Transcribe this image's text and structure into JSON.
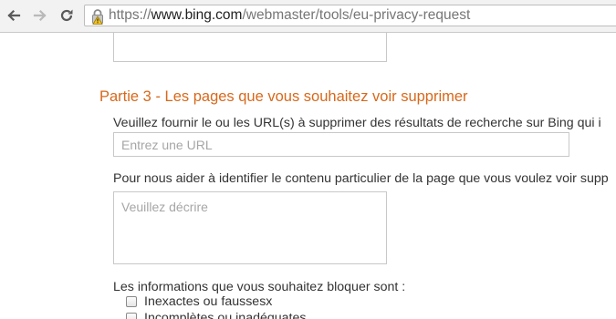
{
  "browser": {
    "url_scheme": "https://",
    "url_host": "www.bing.com",
    "url_path": "/webmaster/tools/eu-privacy-request",
    "icons": {
      "back": "back-arrow-icon",
      "forward": "forward-arrow-icon",
      "reload": "reload-icon",
      "security": "lock-warning-icon"
    }
  },
  "section": {
    "title": "Partie 3 - Les pages que vous souhaitez voir supprimer",
    "title_color": "#d8681a"
  },
  "url_field": {
    "label": "Veuillez fournir le ou les URL(s) à supprimer des résultats de recherche sur Bing qui i",
    "placeholder": "Entrez une URL",
    "value": ""
  },
  "content_field": {
    "label": "Pour nous aider à identifier le contenu particulier de la page que vous voulez voir supp",
    "placeholder": "Veuillez décrire",
    "value": ""
  },
  "info_block": {
    "label": "Les informations que vous souhaitez bloquer sont :",
    "options": [
      {
        "label": "Inexactes ou faussesx",
        "checked": false
      },
      {
        "label": "Incomplètes ou inadéquates",
        "checked": false
      }
    ]
  }
}
